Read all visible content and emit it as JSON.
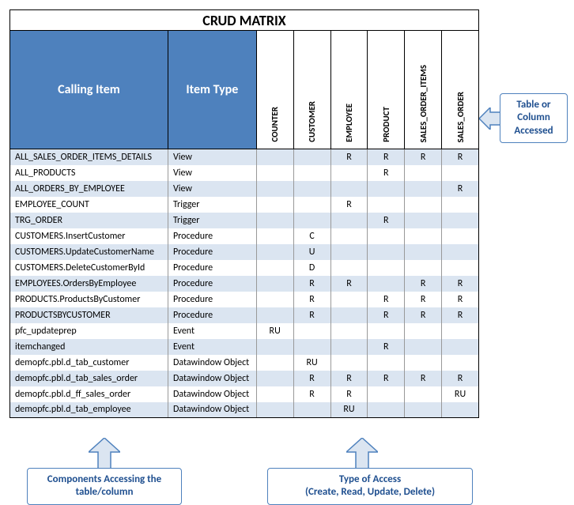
{
  "title": "CRUD MATRIX",
  "header_calling": "Calling Item",
  "header_type": "Item Type",
  "columns": [
    "COUNTER",
    "CUSTOMER",
    "EMPLOYEE",
    "PRODUCT",
    "SALES_ORDER_ITEMS",
    "SALES_ORDER"
  ],
  "rows": [
    {
      "calling": "ALL_SALES_ORDER_ITEMS_DETAILS",
      "type": "View",
      "c": [
        "",
        "",
        "R",
        "R",
        "R",
        "R"
      ]
    },
    {
      "calling": "ALL_PRODUCTS",
      "type": "View",
      "c": [
        "",
        "",
        "",
        "R",
        "",
        ""
      ]
    },
    {
      "calling": "ALL_ORDERS_BY_EMPLOYEE",
      "type": "View",
      "c": [
        "",
        "",
        "",
        "",
        "",
        "R"
      ]
    },
    {
      "calling": "EMPLOYEE_COUNT",
      "type": "Trigger",
      "c": [
        "",
        "",
        "R",
        "",
        "",
        ""
      ]
    },
    {
      "calling": "TRG_ORDER",
      "type": "Trigger",
      "c": [
        "",
        "",
        "",
        "R",
        "",
        ""
      ]
    },
    {
      "calling": "CUSTOMERS.InsertCustomer",
      "type": "Procedure",
      "c": [
        "",
        "C",
        "",
        "",
        "",
        ""
      ]
    },
    {
      "calling": "CUSTOMERS.UpdateCustomerName",
      "type": "Procedure",
      "c": [
        "",
        "U",
        "",
        "",
        "",
        ""
      ]
    },
    {
      "calling": "CUSTOMERS.DeleteCustomerById",
      "type": "Procedure",
      "c": [
        "",
        "D",
        "",
        "",
        "",
        ""
      ]
    },
    {
      "calling": "EMPLOYEES.OrdersByEmployee",
      "type": "Procedure",
      "c": [
        "",
        "R",
        "R",
        "",
        "R",
        "R"
      ]
    },
    {
      "calling": "PRODUCTS.ProductsByCustomer",
      "type": "Procedure",
      "c": [
        "",
        "R",
        "",
        "R",
        "R",
        "R"
      ]
    },
    {
      "calling": "PRODUCTSBYCUSTOMER",
      "type": "Procedure",
      "c": [
        "",
        "R",
        "",
        "R",
        "R",
        "R"
      ]
    },
    {
      "calling": "pfc_updateprep",
      "type": "Event",
      "c": [
        "RU",
        "",
        "",
        "",
        "",
        ""
      ]
    },
    {
      "calling": "itemchanged",
      "type": "Event",
      "c": [
        "",
        "",
        "",
        "R",
        "",
        ""
      ]
    },
    {
      "calling": "demopfc.pbl.d_tab_customer",
      "type": "Datawindow Object",
      "c": [
        "",
        "RU",
        "",
        "",
        "",
        ""
      ]
    },
    {
      "calling": "demopfc.pbl.d_tab_sales_order",
      "type": "Datawindow Object",
      "c": [
        "",
        "R",
        "R",
        "R",
        "R",
        "R"
      ]
    },
    {
      "calling": "demopfc.pbl.d_ff_sales_order",
      "type": "Datawindow Object",
      "c": [
        "",
        "R",
        "R",
        "",
        "",
        "RU"
      ]
    },
    {
      "calling": "demopfc.pbl.d_tab_employee",
      "type": "Datawindow Object",
      "c": [
        "",
        "",
        "RU",
        "",
        "",
        ""
      ]
    }
  ],
  "callouts": {
    "right": "Table or Column Accessed",
    "left": "Components Accessing the table/column",
    "mid": "Type of Access\n(Create, Read, Update, Delete)"
  }
}
